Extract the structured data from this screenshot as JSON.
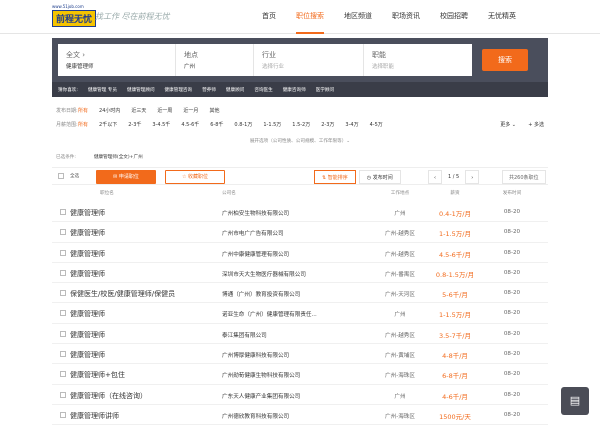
{
  "header": {
    "logo_url": "www.51job.com",
    "logo_text": "前程无忧",
    "slogan": "找工作 尽在前程无忧",
    "nav": [
      "首页",
      "职位搜索",
      "地区频道",
      "职场资讯",
      "校园招聘",
      "无忧精英"
    ]
  },
  "search": {
    "fulltext_label": "全文 ›",
    "fulltext_value": "健康管理师",
    "location_label": "地点",
    "location_value": "广州",
    "industry_label": "行业",
    "industry_placeholder": "选择行业",
    "position_label": "职能",
    "position_placeholder": "选择职能",
    "button": "搜索"
  },
  "hot": {
    "label": "猜你喜欢:",
    "items": [
      "健康管理 专员",
      "健康管理顾问",
      "健康管理咨询",
      "营养师",
      "健康顾问",
      "咨询医生",
      "健康咨询师",
      "医学顾问"
    ]
  },
  "filters": {
    "date": {
      "label": "发布日期:",
      "options": [
        "所有",
        "24小时内",
        "近三天",
        "近一周",
        "近一月",
        "其他"
      ]
    },
    "salary": {
      "label": "月薪范围:",
      "options": [
        "所有",
        "2千以下",
        "2-3千",
        "3-4.5千",
        "4.5-6千",
        "6-8千",
        "0.8-1万",
        "1-1.5万",
        "1.5-2万",
        "2-3万",
        "3-4万",
        "4-5万"
      ],
      "more": "更多 ⌄",
      "multi": "+ 多选"
    }
  },
  "expand": "展开选项（公司性质、公司规模、工作年限等）⌄",
  "conditions": {
    "label": "已选条件:",
    "value": "健康管理师(全文)+广州"
  },
  "toolbar": {
    "select_all": "全选",
    "apply": "申请职位",
    "favorite": "收藏职位",
    "sort_smart": "智能排序",
    "sort_date": "发布时间",
    "page": "1 / 5",
    "total": "共260条职位"
  },
  "columns": [
    "职位名",
    "公司名",
    "工作地点",
    "薪资",
    "发布时间"
  ],
  "jobs": [
    {
      "title": "健康管理师",
      "company": "广州柏安生物科技有限公司",
      "location": "广州",
      "salary": "0.4-1万/月",
      "date": "08-20"
    },
    {
      "title": "健康管理师",
      "company": "广州市电广广告有限公司",
      "location": "广州-越秀区",
      "salary": "1-1.5万/月",
      "date": "08-20"
    },
    {
      "title": "健康管理师",
      "company": "广州中康健康管理有限公司",
      "location": "广州-越秀区",
      "salary": "4.5-6千/月",
      "date": "08-20"
    },
    {
      "title": "健康管理师",
      "company": "深圳市天大生物医疗器械有限公司",
      "location": "广州-番禺区",
      "salary": "0.8-1.5万/月",
      "date": "08-20"
    },
    {
      "title": "保健医生/校医/健康管理师/保健员",
      "company": "博通（广州）教育投资有限公司",
      "location": "广州-天河区",
      "salary": "5-6千/月",
      "date": "08-20"
    },
    {
      "title": "健康管理师",
      "company": "诺亚生命（广州）健康管理有限责任...",
      "location": "广州",
      "salary": "1-1.5万/月",
      "date": "08-20"
    },
    {
      "title": "健康管理师",
      "company": "泰江集团有限公司",
      "location": "广州-越秀区",
      "salary": "3.5-7千/月",
      "date": "08-20"
    },
    {
      "title": "健康管理师",
      "company": "广州博厚健康科技有限公司",
      "location": "广州-黄埔区",
      "salary": "4-8千/月",
      "date": "08-20"
    },
    {
      "title": "健康管理师+包住",
      "company": "广州勋荀健康生物科技有限公司",
      "location": "广州-海珠区",
      "salary": "6-8千/月",
      "date": "08-20"
    },
    {
      "title": "健康管理师（在线咨询）",
      "company": "广东天人健康产业集团有限公司",
      "location": "广州",
      "salary": "4-6千/月",
      "date": "08-20"
    },
    {
      "title": "健康管理师讲师",
      "company": "广州德欣教育科技有限公司",
      "location": "广州-海珠区",
      "salary": "1500元/天",
      "date": "08-20"
    }
  ],
  "chat_icon": "chat-icon"
}
